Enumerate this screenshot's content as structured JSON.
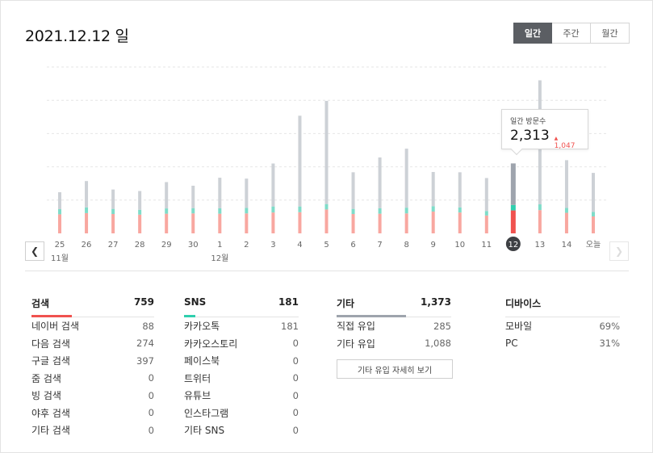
{
  "header": {
    "date_title": "2021.12.12 일"
  },
  "period_tabs": [
    {
      "label": "일간",
      "active": true
    },
    {
      "label": "주간",
      "active": false
    },
    {
      "label": "월간",
      "active": false
    }
  ],
  "colors": {
    "search": "#f8a7a0",
    "sns": "#7fdcc9",
    "other": "#cdd1d6",
    "selected_search": "#f0524f",
    "selected_sns": "#2fcfae",
    "selected_other": "#9ea4ad"
  },
  "chart_data": {
    "type": "bar",
    "stacked": true,
    "categories": [
      "25",
      "26",
      "27",
      "28",
      "29",
      "30",
      "1",
      "2",
      "3",
      "4",
      "5",
      "6",
      "7",
      "8",
      "9",
      "10",
      "11",
      "12",
      "13",
      "14",
      "오늘"
    ],
    "month_labels": [
      {
        "text": "11월",
        "category": "25"
      },
      {
        "text": "12월",
        "category": "1"
      }
    ],
    "selected_category": "12",
    "series": [
      {
        "values": [
          630,
          670,
          640,
          620,
          650,
          660,
          650,
          660,
          690,
          700,
          790,
          640,
          650,
          660,
          720,
          690,
          590,
          759,
          770,
          680,
          560
        ]
      },
      {
        "values": [
          170,
          190,
          170,
          160,
          175,
          175,
          180,
          180,
          200,
          190,
          180,
          170,
          180,
          190,
          180,
          170,
          150,
          181,
          190,
          160,
          150
        ]
      },
      {
        "values": [
          560,
          870,
          640,
          620,
          870,
          740,
          1010,
          970,
          1420,
          3000,
          3410,
          1210,
          1680,
          1950,
          1130,
          1160,
          1090,
          1373,
          4100,
          1580,
          1290
        ]
      }
    ],
    "ylim": [
      0,
      5500
    ],
    "grid": true,
    "tooltip": {
      "label": "일간 방문수",
      "value": "2,313",
      "diff": "1,047"
    }
  },
  "stats": {
    "search": {
      "title": "검색",
      "total": "759",
      "rows": [
        {
          "label": "네이버 검색",
          "value": "88"
        },
        {
          "label": "다음 검색",
          "value": "274"
        },
        {
          "label": "구글 검색",
          "value": "397"
        },
        {
          "label": "줌 검색",
          "value": "0"
        },
        {
          "label": "빙 검색",
          "value": "0"
        },
        {
          "label": "야후 검색",
          "value": "0"
        },
        {
          "label": "기타 검색",
          "value": "0"
        }
      ]
    },
    "sns": {
      "title": "SNS",
      "total": "181",
      "rows": [
        {
          "label": "카카오톡",
          "value": "181"
        },
        {
          "label": "카카오스토리",
          "value": "0"
        },
        {
          "label": "페이스북",
          "value": "0"
        },
        {
          "label": "트위터",
          "value": "0"
        },
        {
          "label": "유튜브",
          "value": "0"
        },
        {
          "label": "인스타그램",
          "value": "0"
        },
        {
          "label": "기타 SNS",
          "value": "0"
        }
      ]
    },
    "other": {
      "title": "기타",
      "total": "1,373",
      "rows": [
        {
          "label": "직접 유입",
          "value": "285"
        },
        {
          "label": "기타 유입",
          "value": "1,088"
        }
      ],
      "detail_button": "기타 유입 자세히 보기"
    },
    "device": {
      "title": "디바이스",
      "rows": [
        {
          "label": "모바일",
          "value": "69%"
        },
        {
          "label": "PC",
          "value": "31%"
        }
      ]
    }
  }
}
